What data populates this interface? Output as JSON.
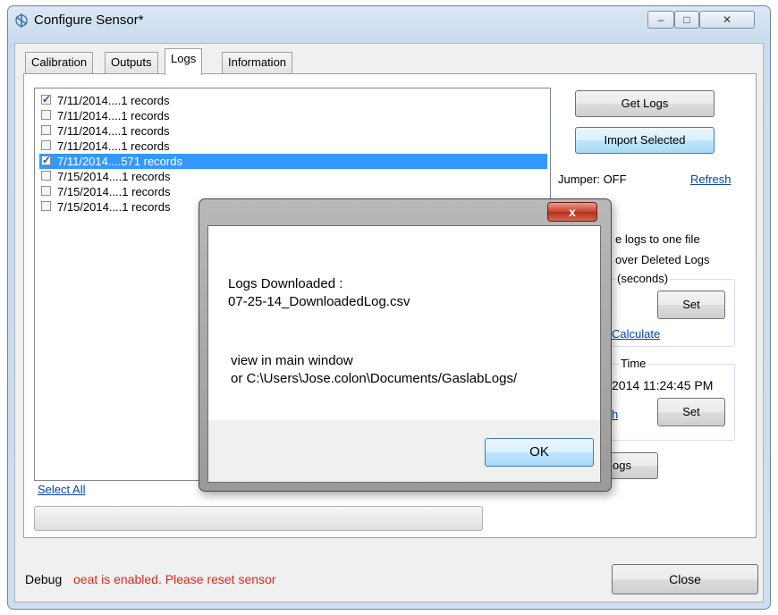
{
  "window": {
    "title": "Configure Sensor*",
    "caption_buttons": {
      "minimize": "–",
      "maximize": "□",
      "close": "✕"
    }
  },
  "tabs": [
    {
      "label": "Calibration"
    },
    {
      "label": "Outputs"
    },
    {
      "label": "Logs",
      "active": true
    },
    {
      "label": "Information"
    }
  ],
  "log_list": [
    {
      "text": "7/11/2014....1 records",
      "checked": true,
      "selected": false
    },
    {
      "text": "7/11/2014....1 records",
      "checked": false,
      "selected": false
    },
    {
      "text": "7/11/2014....1 records",
      "checked": false,
      "selected": false
    },
    {
      "text": "7/11/2014....1 records",
      "checked": false,
      "selected": false
    },
    {
      "text": "7/11/2014....571 records",
      "checked": true,
      "selected": true
    },
    {
      "text": "7/15/2014....1 records",
      "checked": false,
      "selected": false
    },
    {
      "text": "7/15/2014....1 records",
      "checked": false,
      "selected": false
    },
    {
      "text": "7/15/2014....1 records",
      "checked": false,
      "selected": false
    }
  ],
  "right_panel": {
    "get_logs": "Get Logs",
    "import_selected": "Import Selected",
    "jumper": "Jumper: OFF",
    "refresh": "Refresh",
    "option_1": "e logs to one file",
    "option_2": "over Deleted Logs",
    "interval_legend": "(seconds)",
    "set_1": "Set",
    "calculate": "Calculate",
    "time_legend": "Time",
    "time_value": "2014 11:24:45 PM",
    "h_link": "h",
    "set_2": "Set",
    "logs_button": "ogs"
  },
  "select_all": "Select All",
  "status": {
    "debug_label": "Debug",
    "debug_message": "oeat is enabled. Please reset sensor",
    "color": "#d42b1e"
  },
  "close_button": "Close",
  "dialog": {
    "close_glyph": "x",
    "line_1": "Logs Downloaded :",
    "line_2": "07-25-14_DownloadedLog.csv",
    "line_3": "view in main window",
    "line_4": "or C:\\Users\\Jose.colon\\Documents/GaslabLogs/",
    "ok": "OK"
  },
  "progress": 0
}
